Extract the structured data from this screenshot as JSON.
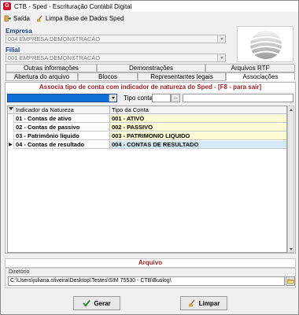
{
  "window": {
    "title": "CTB - Sped - Escrituração Contábil Digital"
  },
  "toolbar": {
    "exit_label": "Saída",
    "clear_label": "Limpa Base de Dados Sped"
  },
  "empresa": {
    "label": "Empresa",
    "value": "004 EMPRESA DEMONSTRACAO"
  },
  "filial": {
    "label": "Filial",
    "value": "001 EMPRESA DEMONSTRACAO"
  },
  "tabs": {
    "row1": [
      "Outras informações",
      "Demonstrações",
      "Arquivos RTF"
    ],
    "row2": [
      "Abertura do arquivo",
      "Blocos",
      "Representantes legais",
      "Associações"
    ],
    "active": "Associações"
  },
  "panel": {
    "banner": "Associa tipo de conta com indicador de natureza do Sped - [F8 - para sair]",
    "tipo_conta_label": "Tipo conta",
    "tipo_btn": "..."
  },
  "grid": {
    "columns": [
      "Indicador da Natureza",
      "Tipo da Conta"
    ],
    "rows": [
      {
        "indicador": "01 - Contas de ativo",
        "tipo": "001 - ATIVO"
      },
      {
        "indicador": "02 - Contas de passivo",
        "tipo": "002 - PASSIVO"
      },
      {
        "indicador": "03 - Patrimônio líquido",
        "tipo": "003 - PATRIMONIO LIQUIDO"
      },
      {
        "indicador": "04 - Contas de resultado",
        "tipo": "004 - CONTAS DE RESULTADO"
      }
    ],
    "selected_row_marker": "▶"
  },
  "arquivo": {
    "header": "Arquivo",
    "diretorio_label": "Diretório",
    "diretorio_value": "C:\\Users\\juliana.oliveira\\Desktop\\Testes\\SIM 75530 - CTB\\Buslog\\"
  },
  "buttons": {
    "gerar": "Gerar",
    "limpar": "Limpar"
  },
  "colors": {
    "banner_text": "#9b1c1c",
    "label_blue": "#1a3c8a",
    "selected_combo": "#0f6fd7",
    "row_highlight": "#fdfbd2"
  }
}
